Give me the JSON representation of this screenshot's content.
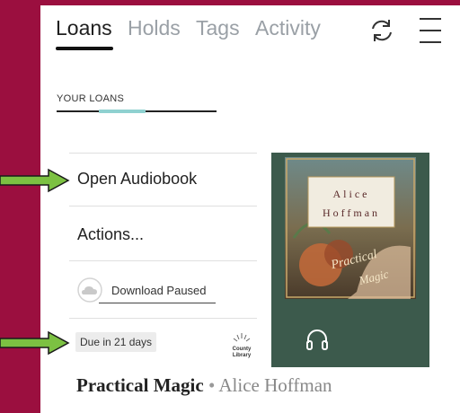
{
  "nav": {
    "tabs": [
      {
        "label": "Loans",
        "active": true
      },
      {
        "label": "Holds",
        "active": false
      },
      {
        "label": "Tags",
        "active": false
      },
      {
        "label": "Activity",
        "active": false
      }
    ],
    "icons": [
      "refresh-icon",
      "menu-icon"
    ]
  },
  "section": {
    "label": "YOUR LOANS"
  },
  "loan": {
    "open_label": "Open Audiobook",
    "actions_label": "Actions...",
    "download_label": "Download Paused",
    "due_label": "Due in 21 days",
    "library_logo_text": [
      "County",
      "Library"
    ],
    "cover": {
      "author_line1": "Alice",
      "author_line2": "Hoffman",
      "title_line1": "Practical",
      "title_line2": "Magic"
    },
    "title": "Practical Magic",
    "separator": "•",
    "author": "Alice Hoffman"
  },
  "colors": {
    "frame": "#9b0f3f",
    "arrow": "#7cc142",
    "cover": "#3c5a4c",
    "accent": "#8fd1d0"
  }
}
